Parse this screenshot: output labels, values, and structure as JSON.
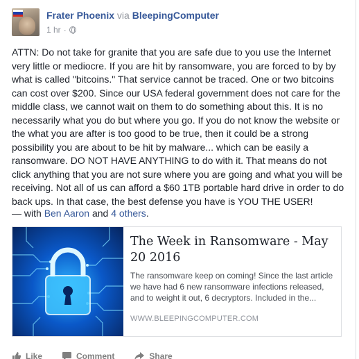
{
  "post": {
    "author": "Frater Phoenix",
    "via_label": "via",
    "page": "BleepingComputer",
    "time": "1 hr",
    "separator": "·",
    "privacy_icon": "globe-icon",
    "body": "ATTN: Do not take for granite that you are safe due to you use the Internet very little or mediocre. If you are hit by ransomware, you are forced to by by what is called \"bitcoins.\" That service cannot be traced. One or two bitcoins can cost over $200. Since our USA federal government does not care for the middle class, we cannot wait on them to do something about this. It is no necessarily what you do but where you go. If you do not know the website or the what you are after is too good to be true, then it could be a strong possibility you are about to be hit by malware... which can be easily a ransomware. DO NOT HAVE ANYTHING to do with it. That means do not click anything that you are not sure where you are going and what you will be receiving. Not all of us can afford a $60 1TB portable hard drive in order to do back ups. In that case, the best defense you have is YOU THE USER!",
    "tag_prefix": "— with",
    "tag_person": "Ben Aaron",
    "tag_and": "and",
    "tag_others": "4 others",
    "tag_period": "."
  },
  "link_card": {
    "title": "The Week in Ransomware - May 20 2016",
    "description": "The ransomware keep on coming! Since the last article we have had 6 new ransomware infections released, and to weight it out, 6 decryptors. Included in the...",
    "domain": "WWW.BLEEPINGCOMPUTER.COM",
    "image_icon": "padlock-circuit-icon"
  },
  "actions": {
    "like": "Like",
    "comment": "Comment",
    "share": "Share"
  },
  "colors": {
    "link": "#365899",
    "meta": "#90949c",
    "text": "#1d2129",
    "border": "#dddfe2"
  }
}
